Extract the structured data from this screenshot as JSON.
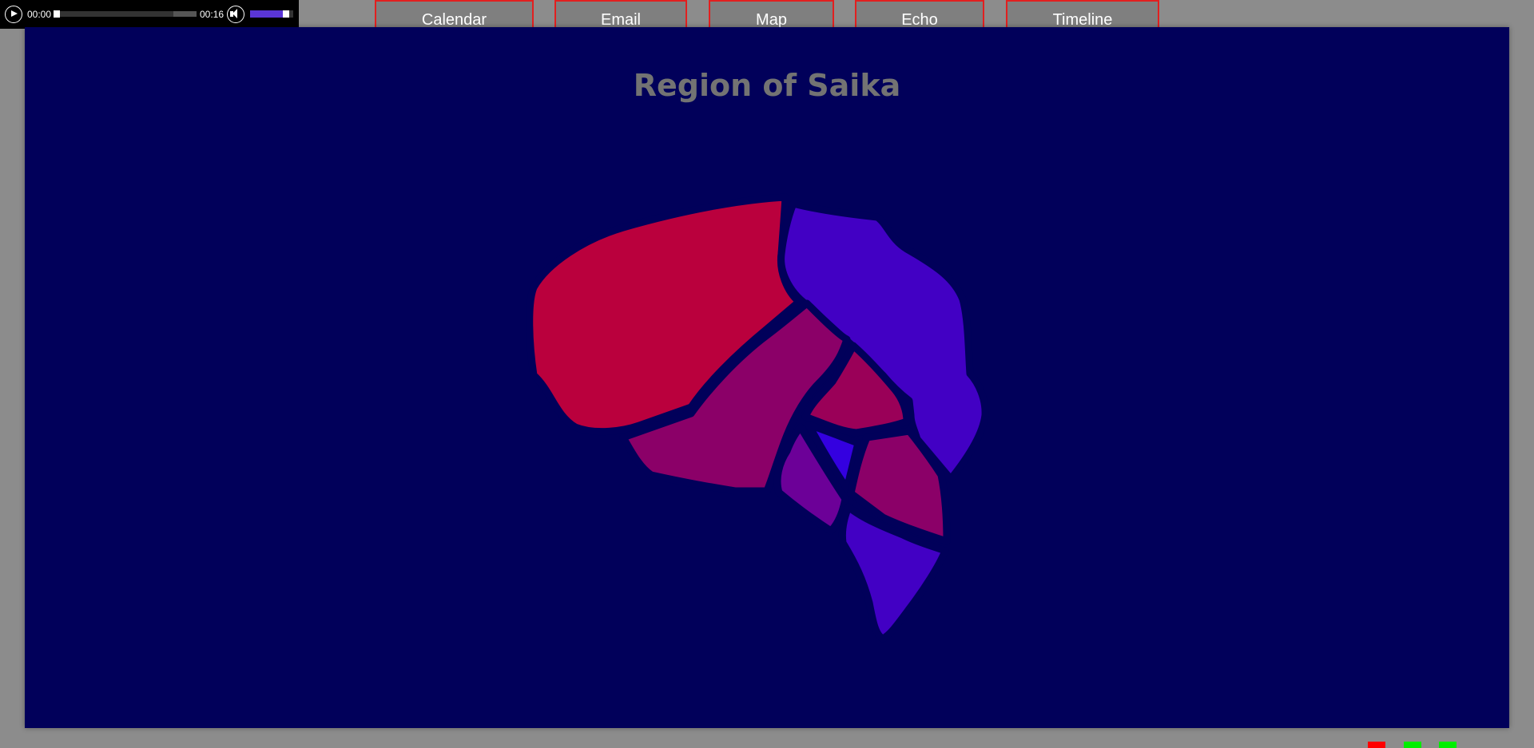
{
  "player": {
    "current_time": "00:00",
    "duration": "00:16",
    "progress": 0.0,
    "volume": 0.9,
    "play_icon": "play-icon",
    "volume_icon": "speaker-icon"
  },
  "nav": {
    "items": [
      "Calendar",
      "Email",
      "Map",
      "Echo",
      "Timeline"
    ]
  },
  "map": {
    "title": "Region of Saika",
    "background_color": "#01005a",
    "regions": [
      {
        "id": "northwest",
        "color": "#ba003d"
      },
      {
        "id": "northeast",
        "color": "#4200c4"
      },
      {
        "id": "central-west",
        "color": "#8b0068"
      },
      {
        "id": "central",
        "color": "#9a0058"
      },
      {
        "id": "inner-triangle",
        "color": "#3400e0"
      },
      {
        "id": "south-west-small",
        "color": "#6c0098"
      },
      {
        "id": "south-central",
        "color": "#8b0068"
      },
      {
        "id": "south",
        "color": "#4200c4"
      }
    ]
  },
  "corner_indicators": [
    "#ff0000",
    "#00ee00",
    "#00ee00"
  ]
}
